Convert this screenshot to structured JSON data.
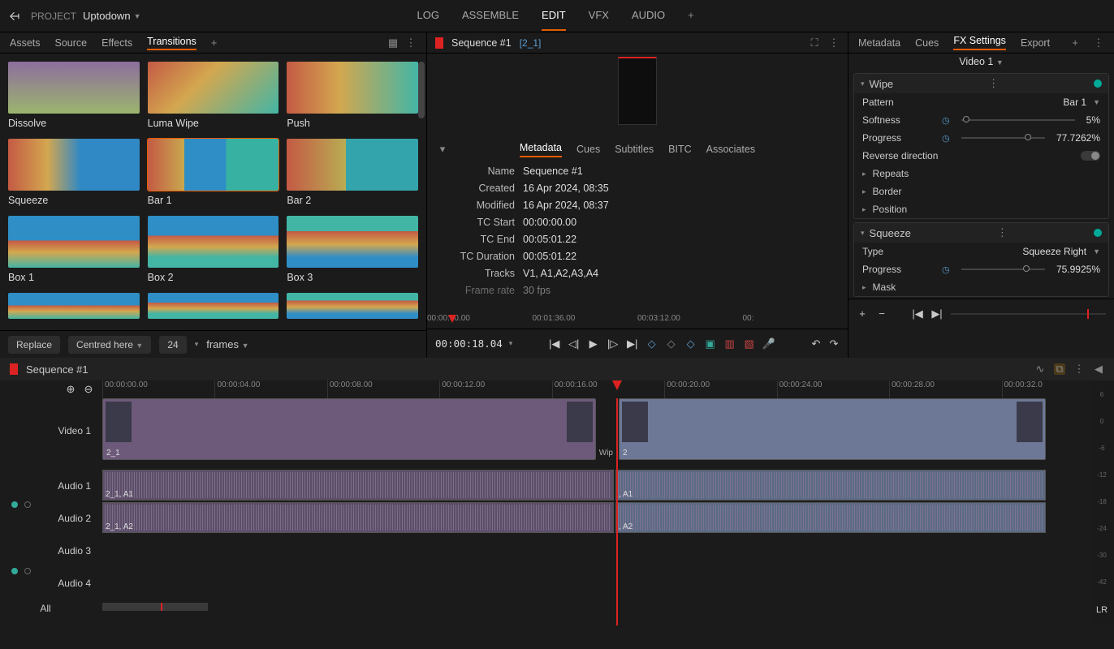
{
  "topbar": {
    "project_label": "PROJECT",
    "project_name": "Uptodown",
    "tabs": [
      "LOG",
      "ASSEMBLE",
      "EDIT",
      "VFX",
      "AUDIO"
    ],
    "active_tab": "EDIT"
  },
  "left_panel": {
    "tabs": [
      "Assets",
      "Source",
      "Effects",
      "Transitions"
    ],
    "active": "Transitions",
    "items": [
      {
        "label": "Dissolve"
      },
      {
        "label": "Luma Wipe"
      },
      {
        "label": "Push"
      },
      {
        "label": "Squeeze"
      },
      {
        "label": "Bar 1",
        "selected": true
      },
      {
        "label": "Bar 2"
      },
      {
        "label": "Box 1"
      },
      {
        "label": "Box 2"
      },
      {
        "label": "Box 3"
      }
    ],
    "bottom": {
      "replace": "Replace",
      "centred": "Centred here",
      "frames_num": "24",
      "frames_lbl": "frames"
    }
  },
  "center": {
    "seq_name": "Sequence #1",
    "seq_sub": "[2_1]",
    "mid_tabs": [
      "Metadata",
      "Cues",
      "Subtitles",
      "BITC",
      "Associates"
    ],
    "mid_active": "Metadata",
    "meta": [
      {
        "k": "Name",
        "v": "Sequence #1"
      },
      {
        "k": "Created",
        "v": "16 Apr 2024, 08:35"
      },
      {
        "k": "Modified",
        "v": "16 Apr 2024, 08:37"
      },
      {
        "k": "TC Start",
        "v": "00:00:00.00"
      },
      {
        "k": "TC End",
        "v": "00:05:01.22"
      },
      {
        "k": "TC Duration",
        "v": "00:05:01.22"
      },
      {
        "k": "Tracks",
        "v": "V1, A1,A2,A3,A4"
      },
      {
        "k": "Frame rate",
        "v": "30 fps"
      }
    ],
    "ruler": [
      "00:00:00.00",
      "00:01:36.00",
      "00:03:12.00",
      "00:"
    ],
    "timecode": "00:00:18.04"
  },
  "right": {
    "tabs": [
      "Metadata",
      "Cues",
      "FX Settings",
      "Export"
    ],
    "active": "FX Settings",
    "title": "Video 1",
    "wipe": {
      "name": "Wipe",
      "pattern_k": "Pattern",
      "pattern_v": "Bar 1",
      "softness_k": "Softness",
      "softness_v": "5%",
      "progress_k": "Progress",
      "progress_v": "77.7262%",
      "reverse_k": "Reverse direction",
      "sub": [
        "Repeats",
        "Border",
        "Position"
      ]
    },
    "squeeze": {
      "name": "Squeeze",
      "type_k": "Type",
      "type_v": "Squeeze Right",
      "progress_k": "Progress",
      "progress_v": "75.9925%",
      "sub": [
        "Mask"
      ]
    }
  },
  "timeline": {
    "seq": "Sequence #1",
    "ticks": [
      "00:00:00.00",
      "00:00:04.00",
      "00:00:08.00",
      "00:00:12.00",
      "00:00:16.00",
      "00:00:20.00",
      "00:00:24.00",
      "00:00:28.00",
      "00:00:32.0"
    ],
    "tracks": {
      "v1": "Video 1",
      "a1": "Audio 1",
      "a2": "Audio 2",
      "a3": "Audio 3",
      "a4": "Audio 4",
      "all": "All"
    },
    "clip1": "2_1",
    "clip1_wipe": "Wip",
    "clip2": "2",
    "a1c1": "2_1, A1",
    "a1c2": ", A1",
    "a2c1": "2_1, A2",
    "a2c2": ", A2",
    "meters": [
      "6",
      "0",
      "-6",
      "-12",
      "-18",
      "-24",
      "-30",
      "-42"
    ],
    "lr": "LR"
  }
}
